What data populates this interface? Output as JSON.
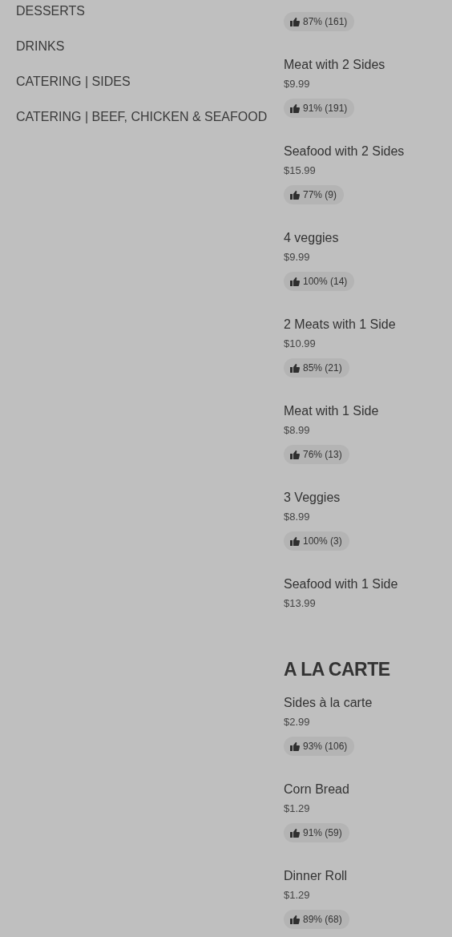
{
  "categories": [
    {
      "label": "DESSERTS"
    },
    {
      "label": "DRINKS"
    },
    {
      "label": "CATERING | SIDES"
    },
    {
      "label": "CATERING | BEEF, CHICKEN & SEAFOOD"
    }
  ],
  "sections": [
    {
      "items": [
        {
          "rating": "87% (161)"
        },
        {
          "name": "Meat with 2 Sides",
          "price": "$9.99",
          "rating": "91% (191)"
        },
        {
          "name": "Seafood with 2 Sides",
          "price": "$15.99",
          "rating": "77% (9)"
        },
        {
          "name": "4 veggies",
          "price": "$9.99",
          "rating": "100% (14)"
        },
        {
          "name": "2 Meats with 1 Side",
          "price": "$10.99",
          "rating": "85% (21)"
        },
        {
          "name": "Meat with 1 Side",
          "price": "$8.99",
          "rating": "76% (13)"
        },
        {
          "name": "3 Veggies",
          "price": "$8.99",
          "rating": "100% (3)"
        },
        {
          "name": "Seafood with 1 Side",
          "price": "$13.99"
        }
      ]
    },
    {
      "title": "A LA CARTE",
      "items": [
        {
          "name": "Sides à la carte",
          "price": "$2.99",
          "rating": "93% (106)"
        },
        {
          "name": "Corn Bread",
          "price": "$1.29",
          "rating": "91% (59)"
        },
        {
          "name": "Dinner Roll",
          "price": "$1.29",
          "rating": "89% (68)"
        }
      ]
    }
  ]
}
